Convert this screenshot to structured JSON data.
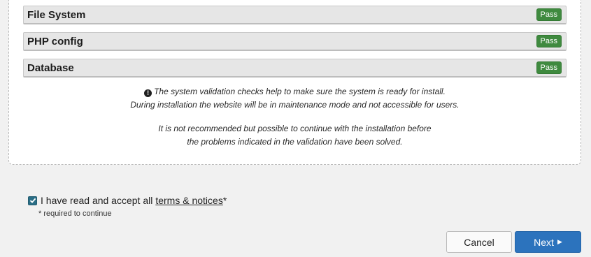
{
  "checks": [
    {
      "title": "File System",
      "status": "Pass"
    },
    {
      "title": "PHP config",
      "status": "Pass"
    },
    {
      "title": "Database",
      "status": "Pass"
    }
  ],
  "info": {
    "icon": "exclamation-circle-icon",
    "line1": "The system validation checks help to make sure the system is ready for install.",
    "line2": "During installation the website will be in maintenance mode and not accessible for users.",
    "line3": "It is not recommended but possible to continue with the installation before",
    "line4": "the problems indicated in the validation have been solved."
  },
  "accept": {
    "checked": true,
    "text": "I have read and accept all",
    "link": "terms & notices",
    "asterisk": "*",
    "note": "* required to continue"
  },
  "buttons": {
    "cancel": "Cancel",
    "next": "Next",
    "next_icon": "caret-right-icon"
  },
  "colors": {
    "pass_badge": "#3f8a3f",
    "primary_button": "#2c73bd",
    "checkbox": "#2a6e86"
  }
}
